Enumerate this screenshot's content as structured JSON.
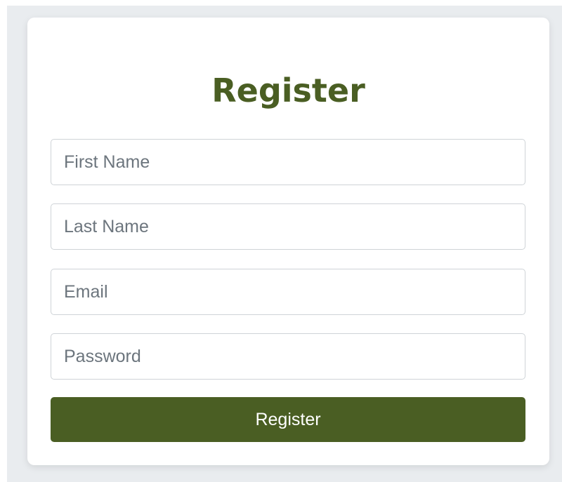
{
  "form": {
    "title": "Register",
    "fields": [
      {
        "name": "first_name",
        "placeholder": "First Name",
        "value": ""
      },
      {
        "name": "last_name",
        "placeholder": "Last Name",
        "value": ""
      },
      {
        "name": "email",
        "placeholder": "Email",
        "value": ""
      },
      {
        "name": "password",
        "placeholder": "Password",
        "value": ""
      }
    ],
    "submit_label": "Register"
  },
  "colors": {
    "accent": "#4a5e23",
    "background": "#e9ecef",
    "card": "#ffffff",
    "border": "#cfd3d7",
    "placeholder": "#6c757d"
  }
}
